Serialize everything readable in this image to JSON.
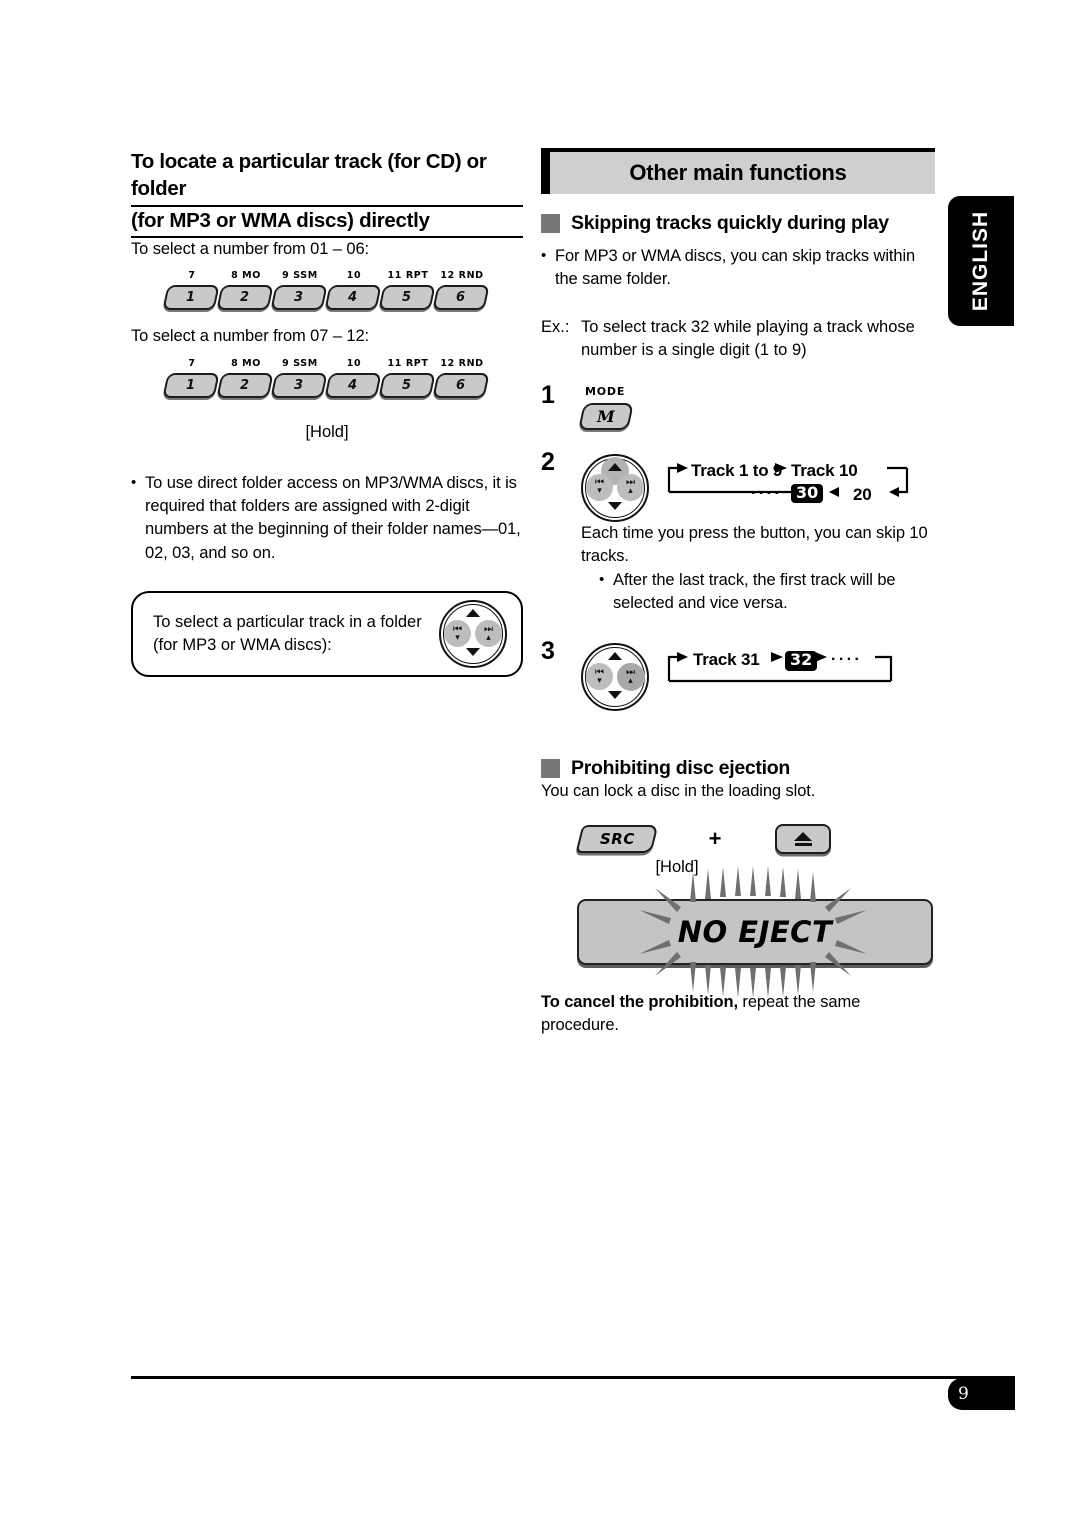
{
  "left": {
    "heading_line1": "To locate a particular track (for CD) or folder",
    "heading_line2": "(for MP3 or WMA discs) directly",
    "intro_1": "To select a number from 01 – 06:",
    "intro_2": "To select a number from 07 – 12:",
    "hold_label": "[Hold]",
    "keypad": {
      "top_labels": [
        "7",
        "8  MO",
        "9  SSM",
        "10",
        "11  RPT",
        "12  RND"
      ],
      "numbers": [
        "1",
        "2",
        "3",
        "4",
        "5",
        "6"
      ]
    },
    "note_bullet": "•",
    "note_text": "To use direct folder access on MP3/WMA discs, it is required that folders are assigned with 2-digit numbers at the beginning of their folder names—01, 02, 03, and so on.",
    "callout_line1": "To select a particular track in a folder",
    "callout_line2": "(for MP3 or WMA discs):"
  },
  "right": {
    "banner_title": "Other main functions",
    "section1_title": "Skipping tracks quickly during play",
    "bullet_dot": "•",
    "bullet1": "For MP3 or WMA discs, you can skip tracks within the same folder.",
    "ex_label": "Ex.:",
    "ex_text": "To select track 32 while playing a track whose number is a single digit (1 to 9)",
    "step1": {
      "number": "1",
      "mode_label": "MODE",
      "mode_key": "M"
    },
    "step2": {
      "number": "2",
      "flow_top_1": "Track 1 to 9",
      "flow_top_2": "Track 10",
      "flow_bottom_dots": "····",
      "flow_bottom_box": "30",
      "flow_bottom_num": "20"
    },
    "step2_note": "Each time you press the button, you can skip 10 tracks.",
    "step2_bullet": "After the last track, the first track will be selected and vice versa.",
    "step3": {
      "number": "3",
      "flow_text": "Track 31",
      "flow_box": "32",
      "flow_dots": "····"
    },
    "section2_title": "Prohibiting disc ejection",
    "section2_text": "You can lock a disc in the loading slot.",
    "src_key": "SRC",
    "plus_sign": "+",
    "hold_label": "[Hold]",
    "display_text": "NO EJECT",
    "cancel_bold": "To cancel the prohibition,",
    "cancel_rest": " repeat the same procedure."
  },
  "sidebar": {
    "language_tab": "ENGLISH"
  },
  "footer": {
    "page_number": "9"
  },
  "colors": {
    "banner_bg": "#cfcfcf",
    "key_fill": "#c9c9c9",
    "square_marker": "#767676",
    "display_bg": "#c4c4c4",
    "highlight": "#b3b3b3"
  }
}
